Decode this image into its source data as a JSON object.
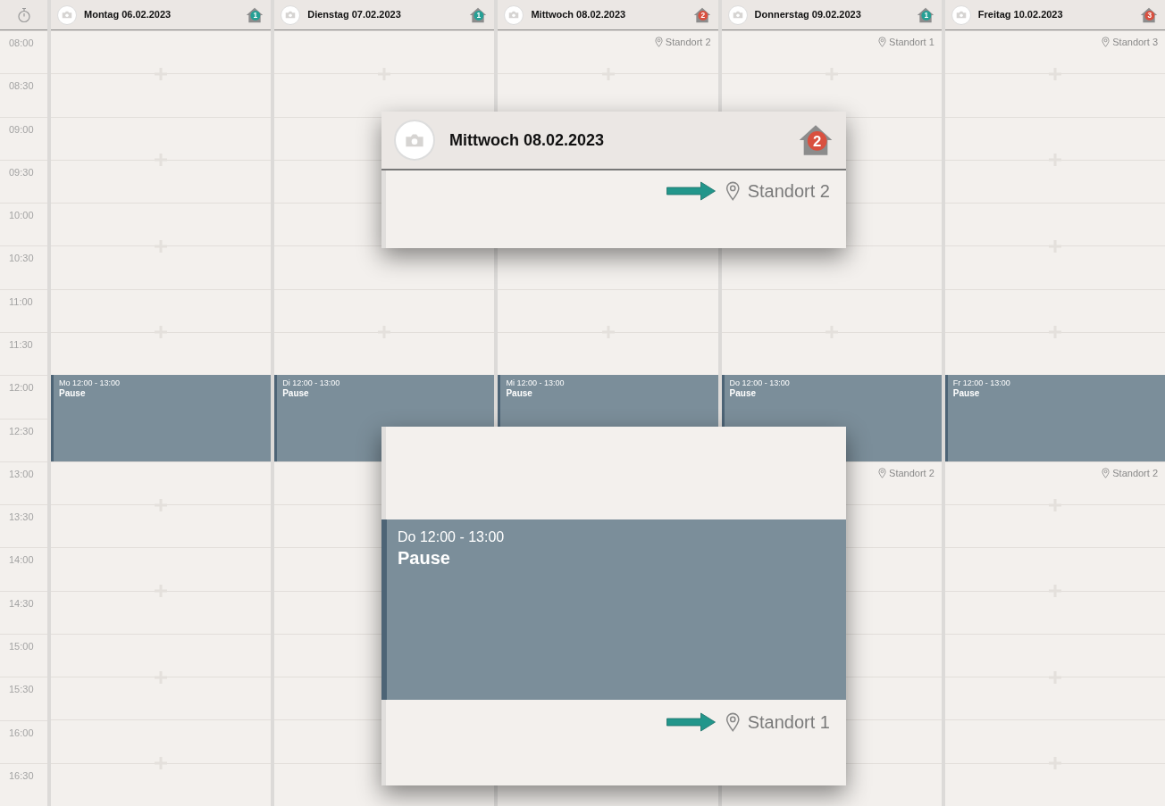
{
  "time_column": {
    "times": [
      "08:00",
      "08:30",
      "09:00",
      "09:30",
      "10:00",
      "10:30",
      "11:00",
      "11:30",
      "12:00",
      "12:30",
      "13:00",
      "13:30",
      "14:00",
      "14:30",
      "15:00",
      "15:30",
      "16:00",
      "16:30"
    ]
  },
  "days": [
    {
      "title": "Montag 06.02.2023",
      "badge": {
        "count": "1",
        "color": "#26a095"
      },
      "segments": [
        {
          "kind": "free"
        },
        {
          "kind": "event",
          "time": "Mo 12:00 - 13:00",
          "title": "Pause"
        },
        {
          "kind": "free"
        }
      ]
    },
    {
      "title": "Dienstag 07.02.2023",
      "badge": {
        "count": "1",
        "color": "#26a095"
      },
      "segments": [
        {
          "kind": "free"
        },
        {
          "kind": "event",
          "time": "Di 12:00 - 13:00",
          "title": "Pause"
        },
        {
          "kind": "free"
        }
      ]
    },
    {
      "title": "Mittwoch 08.02.2023",
      "badge": {
        "count": "2",
        "color": "#d9503f"
      },
      "segments": [
        {
          "kind": "free",
          "location": "Standort 2"
        },
        {
          "kind": "event",
          "time": "Mi 12:00 - 13:00",
          "title": "Pause"
        },
        {
          "kind": "free"
        }
      ]
    },
    {
      "title": "Donnerstag 09.02.2023",
      "badge": {
        "count": "1",
        "color": "#26a095"
      },
      "segments": [
        {
          "kind": "free",
          "location": "Standort 1"
        },
        {
          "kind": "event",
          "time": "Do 12:00 - 13:00",
          "title": "Pause"
        },
        {
          "kind": "free",
          "location": "Standort 2"
        }
      ]
    },
    {
      "title": "Freitag 10.02.2023",
      "badge": {
        "count": "3",
        "color": "#d9503f"
      },
      "segments": [
        {
          "kind": "free",
          "location": "Standort 3"
        },
        {
          "kind": "event",
          "time": "Fr 12:00 - 13:00",
          "title": "Pause"
        },
        {
          "kind": "free",
          "location": "Standort 2"
        }
      ]
    }
  ],
  "callouts": [
    {
      "kind": "header",
      "title": "Mittwoch 08.02.2023",
      "badge": {
        "count": "2",
        "color": "#d9503f"
      },
      "location": "Standort 2"
    },
    {
      "kind": "event",
      "time": "Do 12:00 - 13:00",
      "title": "Pause",
      "location": "Standort 1"
    }
  ]
}
